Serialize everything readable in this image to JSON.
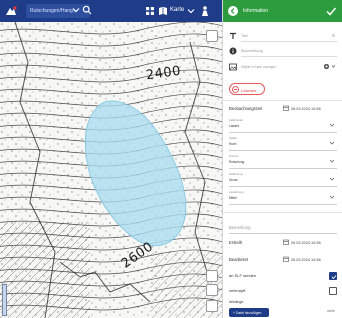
{
  "topbar": {
    "search_value": "Rutschungen/Hang...",
    "layer_label": "Karte"
  },
  "map": {
    "contour_labels": [
      "2400",
      "2600"
    ],
    "colors": {
      "hazard_fill": "#a9ddf0",
      "contour": "#2a2a2a"
    }
  },
  "panel": {
    "title": "Information",
    "fields": [
      {
        "icon": "text-icon",
        "label": "Titel"
      },
      {
        "icon": "info-circle-icon",
        "label": "Beschreibung"
      },
      {
        "icon": "gallery-icon",
        "label": "Objekt in Karte anzeigen"
      }
    ],
    "delete_label": "Löschen",
    "date_row": {
      "label": "Beobachtungszeit",
      "value": "26.03.2024 10:58"
    },
    "selects": [
      {
        "label": "Gefahrenart",
        "value": "Lawine"
      },
      {
        "label": "Gefahr",
        "value": "Hoch"
      },
      {
        "label": "Prozess",
        "value": "Rutschung"
      },
      {
        "label": "Gefährdung",
        "value": "Gross"
      },
      {
        "label": "Ausdehnung",
        "value": "Mittel"
      }
    ],
    "bemerkung_placeholder": "Bemerkung",
    "created_row": {
      "label": "Erstellt",
      "value": "26.03.2024 10:58"
    },
    "edited_row": {
      "label": "Bearbeitet",
      "value": "26.03.2024 10:58"
    },
    "checkboxes": [
      {
        "label": "an SLF senden",
        "checked": true
      },
      {
        "label": "verknüpft",
        "checked": false
      }
    ],
    "attachments_label": "Anhänge",
    "add_button_label": "+ Datei hinzufügen",
    "more_label": "mehr"
  }
}
